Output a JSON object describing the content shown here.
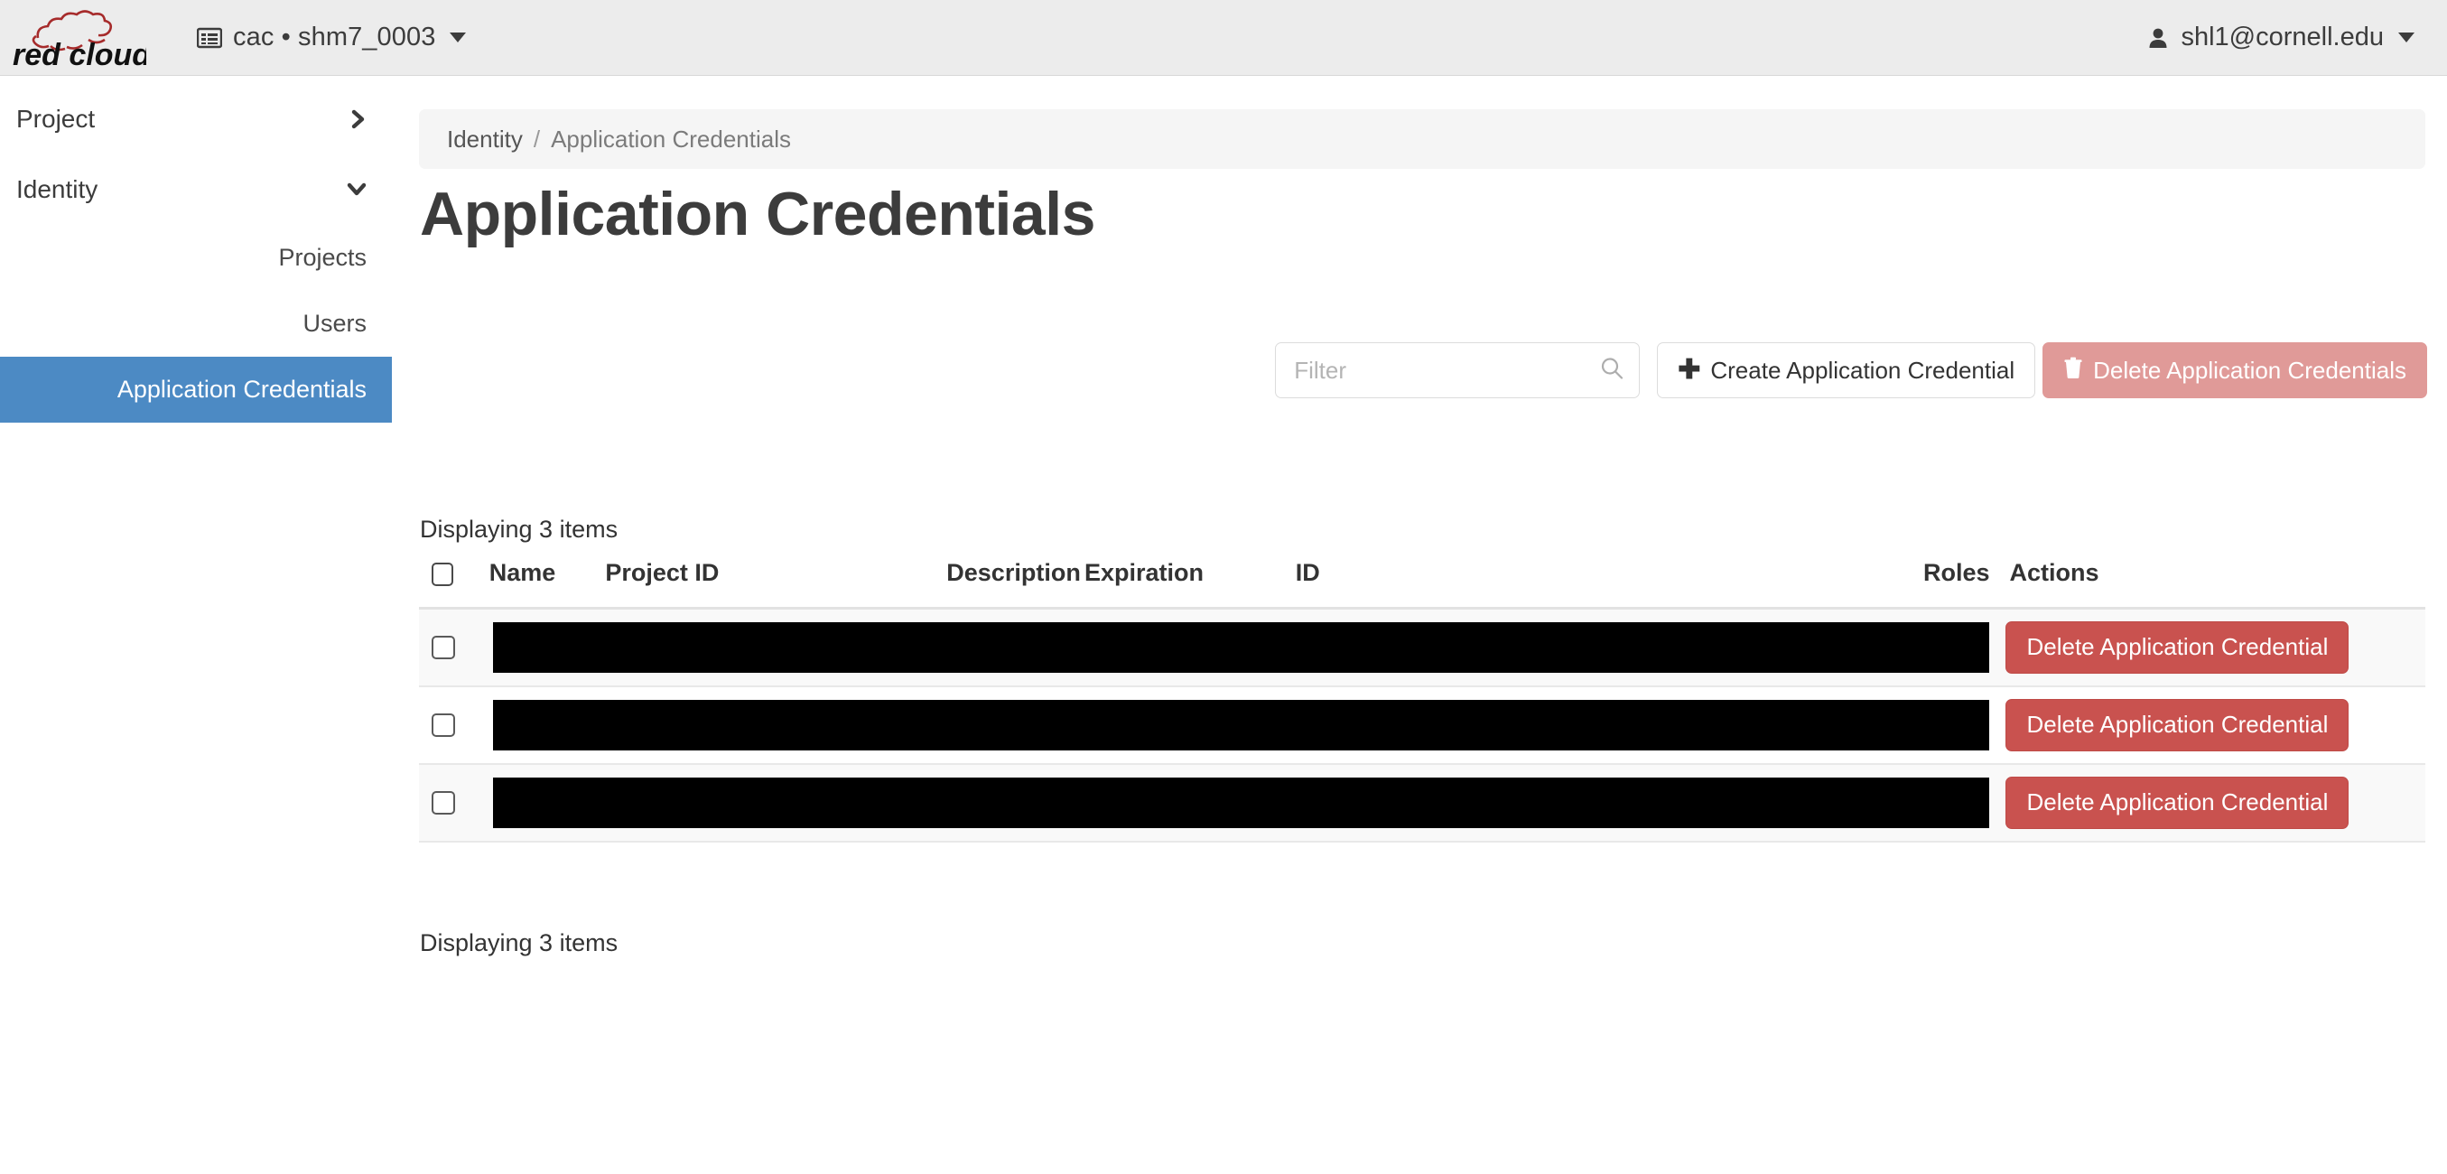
{
  "topbar": {
    "logo_text": "red cloud",
    "logo_icon": "cloud-logo-icon",
    "context_icon": "project-list-icon",
    "context_label": "cac • shm7_0003",
    "context_caret_icon": "caret-down-icon",
    "user_icon": "user-icon",
    "user_label": "shl1@cornell.edu",
    "user_caret_icon": "caret-down-icon"
  },
  "sidebar": {
    "groups": [
      {
        "label": "Project",
        "state": "collapsed",
        "icon": "chevron-right-icon"
      },
      {
        "label": "Identity",
        "state": "expanded",
        "icon": "chevron-down-icon"
      }
    ],
    "items": [
      {
        "label": "Projects",
        "active": false
      },
      {
        "label": "Users",
        "active": false
      },
      {
        "label": "Application Credentials",
        "active": true
      }
    ],
    "active_color": "#4c8ac4"
  },
  "breadcrumb": {
    "parent": "Identity",
    "separator": "/",
    "current": "Application Credentials"
  },
  "page": {
    "title": "Application Credentials"
  },
  "toolbar": {
    "filter_placeholder": "Filter",
    "filter_value": "",
    "search_icon": "search-icon",
    "create_label": "Create Application Credential",
    "create_icon": "plus-icon",
    "delete_label": "Delete Application Credentials",
    "delete_icon": "trash-icon",
    "delete_color": "#e09a98"
  },
  "table": {
    "count_top": "Displaying 3 items",
    "count_bottom": "Displaying 3 items",
    "columns": [
      {
        "key": "check",
        "label": ""
      },
      {
        "key": "name",
        "label": "Name"
      },
      {
        "key": "project",
        "label": "Project ID"
      },
      {
        "key": "desc",
        "label": "Description"
      },
      {
        "key": "exp",
        "label": "Expiration"
      },
      {
        "key": "id",
        "label": "ID"
      },
      {
        "key": "roles",
        "label": "Roles"
      },
      {
        "key": "actions",
        "label": "Actions"
      }
    ],
    "row_action_label": "Delete Application Credential",
    "row_action_color": "#c9524f",
    "rows": [
      {
        "redacted": true,
        "content": "",
        "action": "Delete Application Credential"
      },
      {
        "redacted": true,
        "content": "",
        "action": "Delete Application Credential"
      },
      {
        "redacted": true,
        "content": "",
        "action": "Delete Application Credential"
      }
    ]
  }
}
